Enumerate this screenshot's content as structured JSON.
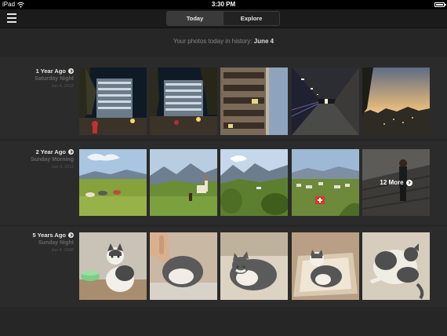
{
  "status_bar": {
    "device": "iPad",
    "time": "3:30 PM"
  },
  "nav": {
    "tabs": [
      {
        "label": "Today",
        "active": true
      },
      {
        "label": "Explore",
        "active": false
      }
    ]
  },
  "header": {
    "prefix": "Your photos today in history:",
    "date": "June 4"
  },
  "sections": [
    {
      "ago": "1 Year Ago",
      "time_of_day": "Saturday Night",
      "date": "Jun 4, 2012",
      "photos": [
        "building-night",
        "building-night-tree",
        "apartment-balconies",
        "corridor-night",
        "city-sunset"
      ]
    },
    {
      "ago": "2 Year Ago",
      "time_of_day": "Sunday Morning",
      "date": "Jun 4, 2011",
      "photos": [
        "meadow-picnic",
        "church-hill",
        "mountain-valley",
        "town-flag",
        "woman-stairs"
      ],
      "more_label": "12 More"
    },
    {
      "ago": "5 Years Ago",
      "time_of_day": "Sunday Night",
      "date": "Jun 4, 2008",
      "photos": [
        "kitten-bowl",
        "kitten-petted",
        "kitten-lying",
        "kitten-box",
        "kitten-playing"
      ]
    }
  ],
  "colors": {
    "background": "#262626",
    "section": "#2b2b2b",
    "text": "#e8e8e8",
    "muted": "#666666"
  }
}
